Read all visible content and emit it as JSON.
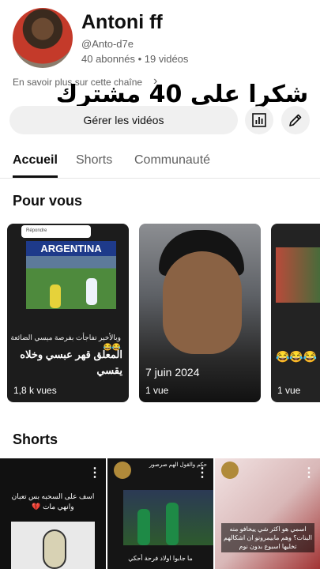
{
  "channel": {
    "name": "Antoni ff",
    "handle": "@Anto-d7e",
    "subscribers": "40 abonnés",
    "separator": "•",
    "videos": "19 vidéos",
    "more_link": "En savoir plus sur cette chaîne",
    "overlay_text": "شكرا على 40 مشترك"
  },
  "actions": {
    "manage_label": "Gérer les vidéos",
    "stats_icon": "analytics-icon",
    "edit_icon": "edit-icon"
  },
  "tabs": [
    {
      "label": "Accueil",
      "active": true
    },
    {
      "label": "Shorts",
      "active": false
    },
    {
      "label": "Communauté",
      "active": false
    }
  ],
  "for_you": {
    "title": "Pour vous",
    "cards": [
      {
        "reply_label": "Répondre",
        "banner_text": "ARGENTINA",
        "subtitle": "وبالأخير تفاجأت بفرصة ميسي الضائعة 😂😂",
        "title": "المعلق قهر عبسي وخلاه يقسي",
        "meta": "1,8 k vues"
      },
      {
        "title": "7 juin 2024",
        "meta": "1 vue"
      },
      {
        "emojis": "😂😂😂",
        "meta": "1 vue"
      }
    ]
  },
  "shorts": {
    "title": "Shorts",
    "items": [
      {
        "caption": "اسف على السحبه بس تعبان وانهي مات 💔"
      },
      {
        "top_caption": "حكم والقول الهم صرصور",
        "bottom_caption": "ما جابوا اولاد فرحة أحكي"
      },
      {
        "caption": "اسمي هو اكثر شي ييخافو منه البنات؟ وهم مابيمرونو ان اشكالهم تخليها اسبوع بدون نوم"
      }
    ]
  },
  "colors": {
    "text_primary": "#0f0f0f",
    "text_secondary": "#606060",
    "chip_bg": "#f0f0f0"
  }
}
